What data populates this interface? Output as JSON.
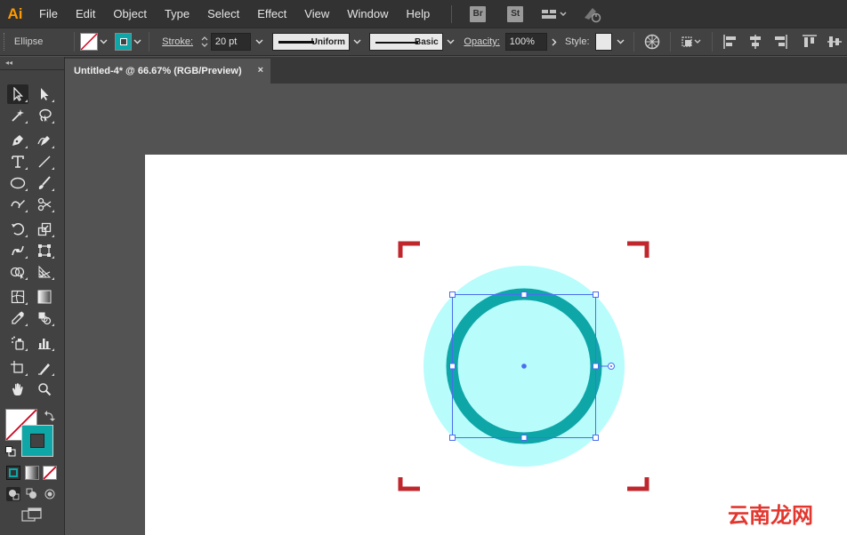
{
  "app": {
    "logo_text": "Ai",
    "logo_color": "#ff9a00"
  },
  "menu": [
    "File",
    "Edit",
    "Object",
    "Type",
    "Select",
    "Effect",
    "View",
    "Window",
    "Help"
  ],
  "bridge_icons": [
    {
      "name": "bridge-icon",
      "label": "Br"
    },
    {
      "name": "stock-icon",
      "label": "St"
    }
  ],
  "control": {
    "selection_type": "Ellipse",
    "stroke_label": "Stroke:",
    "stroke_weight": "20 pt",
    "variable_width_label": "Uniform",
    "brush_label": "Basic",
    "opacity_label": "Opacity:",
    "opacity_value": "100%",
    "style_label": "Style:",
    "fill_color": "none",
    "stroke_color": "#0fa6a8"
  },
  "document_tab": {
    "title": "Untitled-4* @ 66.67% (RGB/Preview)",
    "close_glyph": "×"
  },
  "tools": [
    {
      "name": "selection-tool",
      "glyph": "arrow",
      "active": true
    },
    {
      "name": "direct-selection-tool",
      "glyph": "arrow-solid"
    },
    {
      "name": "magic-wand-tool",
      "glyph": "wand"
    },
    {
      "name": "lasso-tool",
      "glyph": "lasso"
    },
    {
      "name": "pen-tool",
      "glyph": "pen"
    },
    {
      "name": "curvature-tool",
      "glyph": "curvature"
    },
    {
      "name": "type-tool",
      "glyph": "T"
    },
    {
      "name": "line-segment-tool",
      "glyph": "line"
    },
    {
      "name": "ellipse-tool",
      "glyph": "ellipse"
    },
    {
      "name": "paintbrush-tool",
      "glyph": "brush"
    },
    {
      "name": "shaper-tool",
      "glyph": "shaper"
    },
    {
      "name": "scissors-tool",
      "glyph": "scissors"
    },
    {
      "name": "rotate-tool",
      "glyph": "rotate"
    },
    {
      "name": "scale-tool",
      "glyph": "scale"
    },
    {
      "name": "warp-tool",
      "glyph": "warp"
    },
    {
      "name": "free-transform-tool",
      "glyph": "freetransform"
    },
    {
      "name": "shape-builder-tool",
      "glyph": "shapebuilder"
    },
    {
      "name": "perspective-grid-tool",
      "glyph": "perspective"
    },
    {
      "name": "mesh-tool",
      "glyph": "mesh"
    },
    {
      "name": "gradient-tool",
      "glyph": "gradient"
    },
    {
      "name": "eyedropper-tool",
      "glyph": "eyedropper"
    },
    {
      "name": "blend-tool",
      "glyph": "blend"
    },
    {
      "name": "symbol-sprayer-tool",
      "glyph": "symbol"
    },
    {
      "name": "column-graph-tool",
      "glyph": "graph"
    },
    {
      "name": "artboard-tool",
      "glyph": "artboard"
    },
    {
      "name": "slice-tool",
      "glyph": "slice"
    },
    {
      "name": "hand-tool",
      "glyph": "hand"
    },
    {
      "name": "zoom-tool",
      "glyph": "zoom"
    }
  ],
  "colors": {
    "accent_teal": "#0fa6a8",
    "light_cyan": "#b8fcfc",
    "corner_red": "#c0272d",
    "selection_blue": "#4a6cf0",
    "watermark_red": "#e2372e"
  },
  "watermark": {
    "text": "云南龙网"
  }
}
